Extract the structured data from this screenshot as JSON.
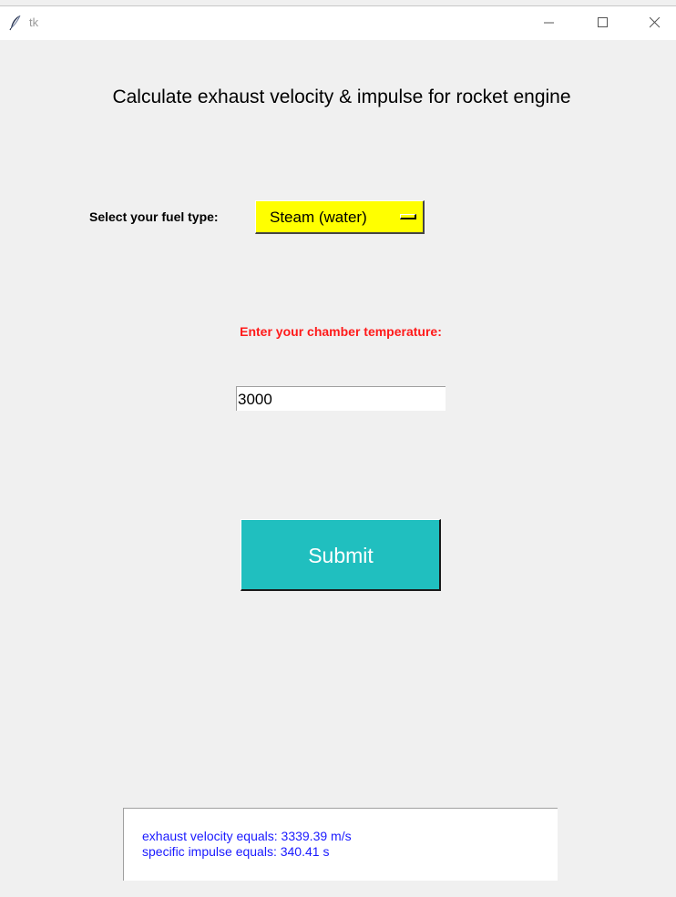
{
  "window": {
    "title": "tk",
    "app_icon": "feather-icon",
    "controls": {
      "minimize_icon": "minimize-icon",
      "maximize_icon": "maximize-icon",
      "close_icon": "close-icon"
    }
  },
  "main": {
    "heading": "Calculate exhaust velocity & impulse for rocket engine",
    "fuel": {
      "label": "Select your fuel type:",
      "selected": "Steam (water)",
      "background_color": "#ffff00"
    },
    "temperature": {
      "label": "Enter your chamber temperature:",
      "label_color": "#ff1a1a",
      "value": "3000"
    },
    "submit": {
      "label": "Submit",
      "background_color": "#20bfbf"
    },
    "output": {
      "line1": "exhaust velocity equals: 3339.39 m/s",
      "line2": "specific impulse equals: 340.41 s",
      "text_color": "#1a1aff"
    }
  }
}
